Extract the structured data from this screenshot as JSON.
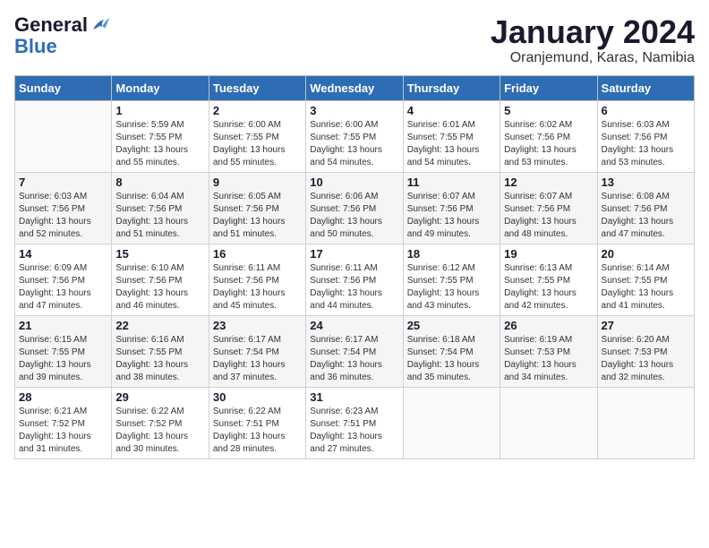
{
  "header": {
    "logo_line1": "General",
    "logo_line2": "Blue",
    "month_title": "January 2024",
    "location": "Oranjemund, Karas, Namibia"
  },
  "columns": [
    "Sunday",
    "Monday",
    "Tuesday",
    "Wednesday",
    "Thursday",
    "Friday",
    "Saturday"
  ],
  "weeks": [
    [
      {
        "day": "",
        "info": ""
      },
      {
        "day": "1",
        "info": "Sunrise: 5:59 AM\nSunset: 7:55 PM\nDaylight: 13 hours\nand 55 minutes."
      },
      {
        "day": "2",
        "info": "Sunrise: 6:00 AM\nSunset: 7:55 PM\nDaylight: 13 hours\nand 55 minutes."
      },
      {
        "day": "3",
        "info": "Sunrise: 6:00 AM\nSunset: 7:55 PM\nDaylight: 13 hours\nand 54 minutes."
      },
      {
        "day": "4",
        "info": "Sunrise: 6:01 AM\nSunset: 7:55 PM\nDaylight: 13 hours\nand 54 minutes."
      },
      {
        "day": "5",
        "info": "Sunrise: 6:02 AM\nSunset: 7:56 PM\nDaylight: 13 hours\nand 53 minutes."
      },
      {
        "day": "6",
        "info": "Sunrise: 6:03 AM\nSunset: 7:56 PM\nDaylight: 13 hours\nand 53 minutes."
      }
    ],
    [
      {
        "day": "7",
        "info": "Sunrise: 6:03 AM\nSunset: 7:56 PM\nDaylight: 13 hours\nand 52 minutes."
      },
      {
        "day": "8",
        "info": "Sunrise: 6:04 AM\nSunset: 7:56 PM\nDaylight: 13 hours\nand 51 minutes."
      },
      {
        "day": "9",
        "info": "Sunrise: 6:05 AM\nSunset: 7:56 PM\nDaylight: 13 hours\nand 51 minutes."
      },
      {
        "day": "10",
        "info": "Sunrise: 6:06 AM\nSunset: 7:56 PM\nDaylight: 13 hours\nand 50 minutes."
      },
      {
        "day": "11",
        "info": "Sunrise: 6:07 AM\nSunset: 7:56 PM\nDaylight: 13 hours\nand 49 minutes."
      },
      {
        "day": "12",
        "info": "Sunrise: 6:07 AM\nSunset: 7:56 PM\nDaylight: 13 hours\nand 48 minutes."
      },
      {
        "day": "13",
        "info": "Sunrise: 6:08 AM\nSunset: 7:56 PM\nDaylight: 13 hours\nand 47 minutes."
      }
    ],
    [
      {
        "day": "14",
        "info": "Sunrise: 6:09 AM\nSunset: 7:56 PM\nDaylight: 13 hours\nand 47 minutes."
      },
      {
        "day": "15",
        "info": "Sunrise: 6:10 AM\nSunset: 7:56 PM\nDaylight: 13 hours\nand 46 minutes."
      },
      {
        "day": "16",
        "info": "Sunrise: 6:11 AM\nSunset: 7:56 PM\nDaylight: 13 hours\nand 45 minutes."
      },
      {
        "day": "17",
        "info": "Sunrise: 6:11 AM\nSunset: 7:56 PM\nDaylight: 13 hours\nand 44 minutes."
      },
      {
        "day": "18",
        "info": "Sunrise: 6:12 AM\nSunset: 7:55 PM\nDaylight: 13 hours\nand 43 minutes."
      },
      {
        "day": "19",
        "info": "Sunrise: 6:13 AM\nSunset: 7:55 PM\nDaylight: 13 hours\nand 42 minutes."
      },
      {
        "day": "20",
        "info": "Sunrise: 6:14 AM\nSunset: 7:55 PM\nDaylight: 13 hours\nand 41 minutes."
      }
    ],
    [
      {
        "day": "21",
        "info": "Sunrise: 6:15 AM\nSunset: 7:55 PM\nDaylight: 13 hours\nand 39 minutes."
      },
      {
        "day": "22",
        "info": "Sunrise: 6:16 AM\nSunset: 7:55 PM\nDaylight: 13 hours\nand 38 minutes."
      },
      {
        "day": "23",
        "info": "Sunrise: 6:17 AM\nSunset: 7:54 PM\nDaylight: 13 hours\nand 37 minutes."
      },
      {
        "day": "24",
        "info": "Sunrise: 6:17 AM\nSunset: 7:54 PM\nDaylight: 13 hours\nand 36 minutes."
      },
      {
        "day": "25",
        "info": "Sunrise: 6:18 AM\nSunset: 7:54 PM\nDaylight: 13 hours\nand 35 minutes."
      },
      {
        "day": "26",
        "info": "Sunrise: 6:19 AM\nSunset: 7:53 PM\nDaylight: 13 hours\nand 34 minutes."
      },
      {
        "day": "27",
        "info": "Sunrise: 6:20 AM\nSunset: 7:53 PM\nDaylight: 13 hours\nand 32 minutes."
      }
    ],
    [
      {
        "day": "28",
        "info": "Sunrise: 6:21 AM\nSunset: 7:52 PM\nDaylight: 13 hours\nand 31 minutes."
      },
      {
        "day": "29",
        "info": "Sunrise: 6:22 AM\nSunset: 7:52 PM\nDaylight: 13 hours\nand 30 minutes."
      },
      {
        "day": "30",
        "info": "Sunrise: 6:22 AM\nSunset: 7:51 PM\nDaylight: 13 hours\nand 28 minutes."
      },
      {
        "day": "31",
        "info": "Sunrise: 6:23 AM\nSunset: 7:51 PM\nDaylight: 13 hours\nand 27 minutes."
      },
      {
        "day": "",
        "info": ""
      },
      {
        "day": "",
        "info": ""
      },
      {
        "day": "",
        "info": ""
      }
    ]
  ]
}
